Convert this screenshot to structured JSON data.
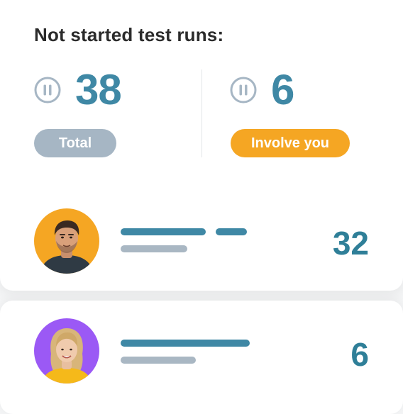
{
  "widget": {
    "title": "Not started test runs:",
    "total": {
      "icon": "pause-circle-icon",
      "value": "38",
      "label": "Total"
    },
    "involve_you": {
      "icon": "pause-circle-icon",
      "value": "6",
      "label": "Involve you"
    }
  },
  "rows": [
    {
      "avatar": "man-avatar",
      "count": "32"
    },
    {
      "avatar": "woman-avatar",
      "count": "6"
    }
  ],
  "colors": {
    "accent": "#3f88a5",
    "muted": "#a6b6c4",
    "highlight": "#f5a623",
    "avatar_bg_1": "#f5a623",
    "avatar_bg_2": "#9b59f5"
  }
}
